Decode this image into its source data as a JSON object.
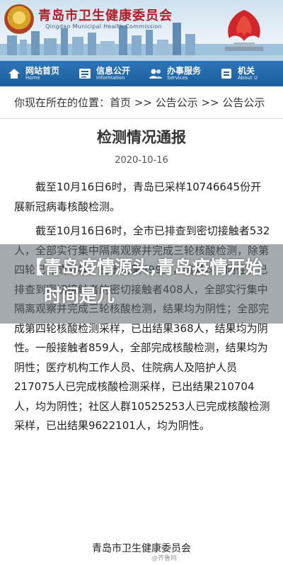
{
  "header": {
    "site_title": "青岛市卫生健康委员会",
    "site_subtitle": "Qingdao Municipal Health Commission"
  },
  "nav": {
    "items": [
      {
        "label": "网站首页",
        "sub": "Home",
        "icon": "home-icon"
      },
      {
        "label": "信息公开",
        "sub": "Information",
        "icon": "info-list-icon"
      },
      {
        "label": "办事服务",
        "sub": "Services",
        "icon": "service-people-icon"
      },
      {
        "label": "机关",
        "sub": "About U",
        "icon": "about-icon"
      }
    ]
  },
  "breadcrumb": {
    "prefix": "你现在所在的位置：",
    "path": "首页 >> 公告公示 >> 公告公示"
  },
  "article": {
    "title": "检测情况通报",
    "date": "2020-10-16",
    "paragraph1": "截至10月16日6时，青岛已采样10746645份开展新冠病毒核酸检测。",
    "paragraph2": "截至10月16日6时，全市已排查到密切接触者532人，全部实行集中隔离观察并完成三轮核酸检测，除第四轮已完成采样，已出结果499人，结果均为阴性。已排查到密切接触者的密切接触者408人，全部实行集中隔离观察并完成三轮核酸检测，结果均为阴性；全部完成第四轮核酸检测采样，已出结果368人，结果均为阴性。一般接触者859人，全部完成核酸检测，结果均为阴性；医疗机构工作人员、住院病人及陪护人员217075人已完成核酸检测采样，已出结果210704人，均为阴性；社区人群10525253人已完成核酸检测采样，已出结果9622101人，均为阴性。",
    "signature": "青岛市卫生健康委员会"
  },
  "overlay": {
    "bracket": "【",
    "headline": "青岛疫情源头,青岛疫情开始时间是几"
  },
  "watermark": "@齐鲁网"
}
